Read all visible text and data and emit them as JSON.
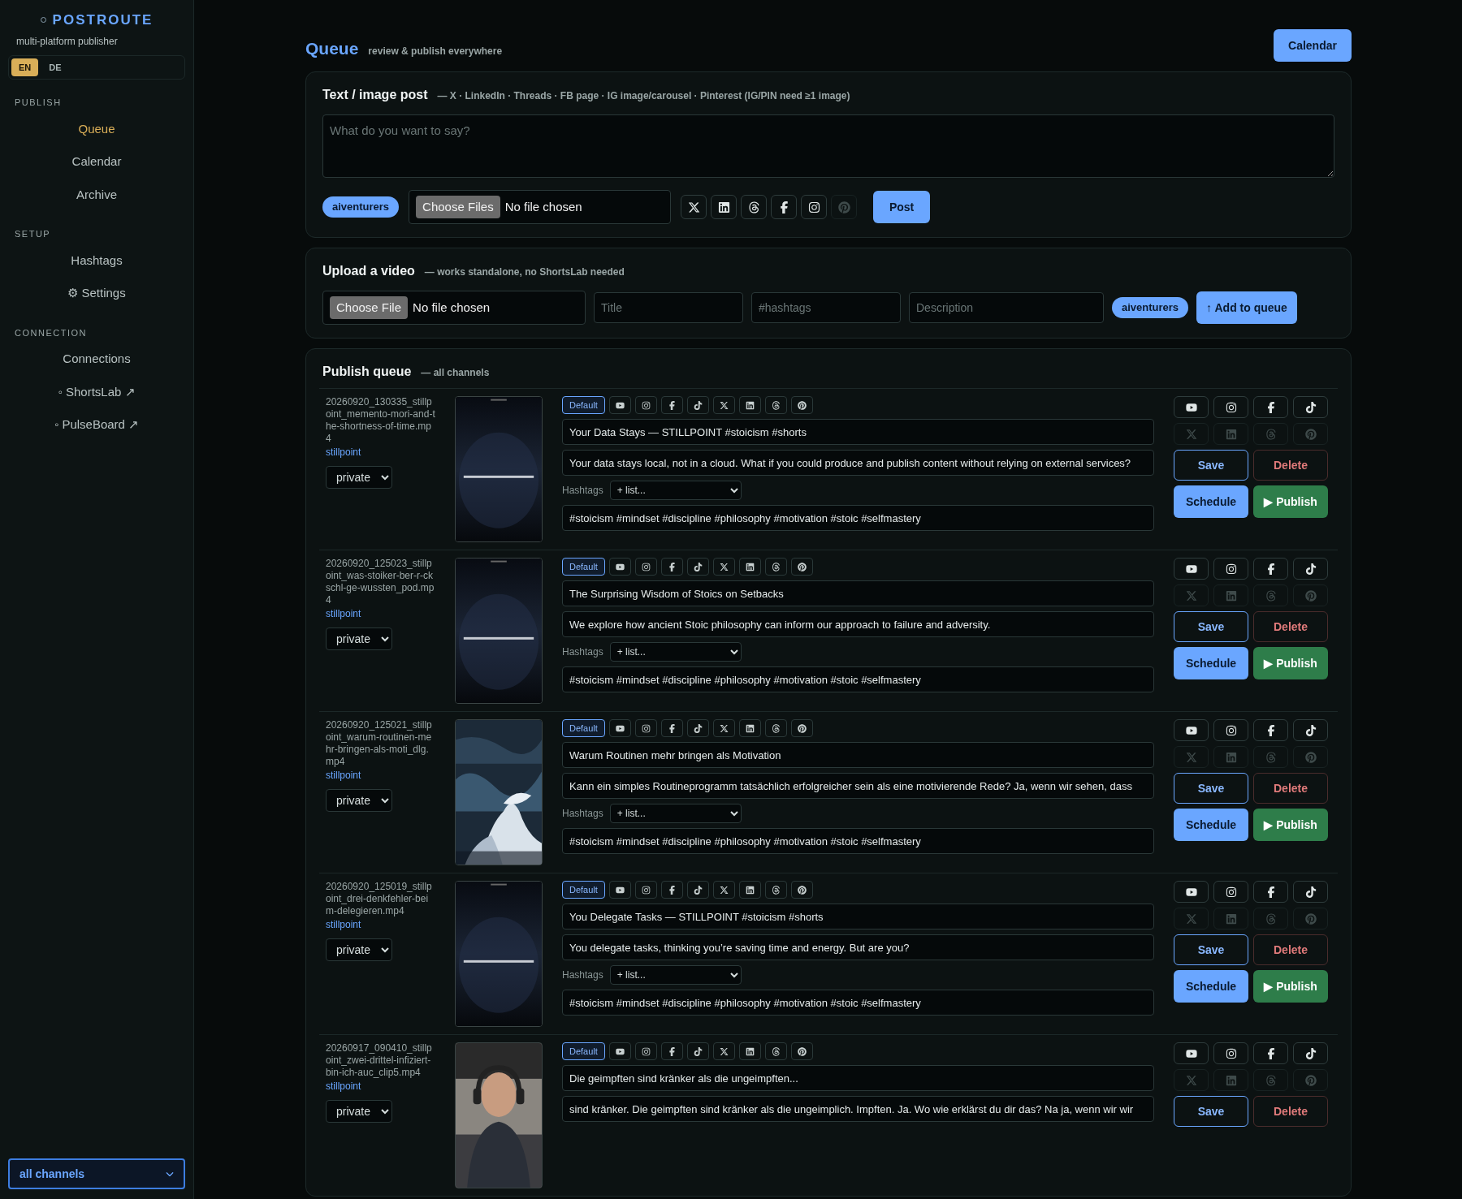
{
  "sidebar": {
    "brand": "POSTROUTE",
    "tagline": "multi-platform publisher",
    "languages": [
      {
        "label": "EN",
        "selected": true
      },
      {
        "label": "DE",
        "selected": false
      }
    ],
    "sections": [
      {
        "title": "PUBLISH",
        "items": [
          {
            "label": "Queue",
            "selected": true
          },
          {
            "label": "Calendar",
            "selected": false
          },
          {
            "label": "Archive",
            "selected": false
          }
        ]
      },
      {
        "title": "SETUP",
        "items": [
          {
            "label": "Hashtags",
            "selected": false
          },
          {
            "label": "⚙ Settings",
            "selected": false
          }
        ]
      },
      {
        "title": "CONNECTION",
        "items": [
          {
            "label": "Connections",
            "selected": false
          },
          {
            "label": "◦ ShortsLab ↗",
            "selected": false
          },
          {
            "label": "◦ PulseBoard ↗",
            "selected": false
          }
        ]
      }
    ],
    "channel_filter": "all channels"
  },
  "header": {
    "title": "Queue",
    "subtitle": "review & publish everywhere",
    "button": "Calendar"
  },
  "text_post": {
    "title": "Text / image post",
    "note": "— X · LinkedIn · Threads · FB page · IG image/carousel · Pinterest (IG/PIN need ≥1 image)",
    "placeholder": "What do you want to say?",
    "account": "aiventurers",
    "file_button": "Choose Files",
    "file_status": "No file chosen",
    "platforms": [
      {
        "kind": "x",
        "on": true
      },
      {
        "kind": "linkedin",
        "on": true
      },
      {
        "kind": "threads",
        "on": true
      },
      {
        "kind": "facebook",
        "on": true
      },
      {
        "kind": "instagram",
        "on": true
      },
      {
        "kind": "pinterest",
        "on": false
      }
    ],
    "submit": "Post"
  },
  "video_upload": {
    "title": "Upload a video",
    "note": "— works standalone, no ShortsLab needed",
    "file_button": "Choose File",
    "file_status": "No file chosen",
    "fields": [
      {
        "placeholder": "Title"
      },
      {
        "placeholder": "#hashtags"
      },
      {
        "placeholder": "Description"
      }
    ],
    "account": "aiventurers",
    "submit": "↑ Add to queue"
  },
  "queue": {
    "title": "Publish queue",
    "note": "— all channels",
    "rows": [
      {
        "file": "20260920_130335_stillpoint_memento-mori-and-the-shortness-of-time.mp4",
        "channel": "stillpoint",
        "privacy": "private",
        "tabs": [
          {
            "kind": "default",
            "label": "Default",
            "selected": true
          },
          {
            "kind": "youtube",
            "selected": false
          },
          {
            "kind": "instagram",
            "selected": false
          },
          {
            "kind": "facebook",
            "selected": false
          },
          {
            "kind": "tiktok",
            "selected": false
          },
          {
            "kind": "x",
            "selected": false
          },
          {
            "kind": "linkedin",
            "selected": false
          },
          {
            "kind": "threads",
            "selected": false
          },
          {
            "kind": "pinterest",
            "selected": false
          }
        ],
        "title": "Your Data Stays — STILLPOINT #stoicism #shorts",
        "description": "Your data stays local, not in a cloud. What if you could produce and publish content without relying on external services?",
        "hashtags_label": "Hashtags",
        "hashtag_list": "+ list...",
        "hashtags": "#stoicism #mindset #discipline #philosophy #motivation #stoic #selfmastery",
        "platforms": [
          {
            "kind": "youtube",
            "on": true
          },
          {
            "kind": "instagram",
            "on": true
          },
          {
            "kind": "facebook",
            "on": true
          },
          {
            "kind": "tiktok",
            "on": true
          },
          {
            "kind": "x",
            "on": false
          },
          {
            "kind": "linkedin",
            "on": false
          },
          {
            "kind": "threads",
            "on": false
          },
          {
            "kind": "pinterest",
            "on": false
          }
        ],
        "save": "Save",
        "delete": "Delete",
        "schedule": "Schedule",
        "publish": "▶ Publish"
      },
      {
        "file": "20260920_125023_stillpoint_was-stoiker-ber-r-ckschl-ge-wussten_pod.mp4",
        "channel": "stillpoint",
        "privacy": "private",
        "tabs": [
          {
            "kind": "default",
            "label": "Default",
            "selected": true
          },
          {
            "kind": "youtube",
            "selected": false
          },
          {
            "kind": "instagram",
            "selected": false
          },
          {
            "kind": "facebook",
            "selected": false
          },
          {
            "kind": "tiktok",
            "selected": false
          },
          {
            "kind": "x",
            "selected": false
          },
          {
            "kind": "linkedin",
            "selected": false
          },
          {
            "kind": "threads",
            "selected": false
          },
          {
            "kind": "pinterest",
            "selected": false
          }
        ],
        "title": "The Surprising Wisdom of Stoics on Setbacks",
        "description": "We explore how ancient Stoic philosophy can inform our approach to failure and adversity.",
        "hashtags_label": "Hashtags",
        "hashtag_list": "+ list...",
        "hashtags": "#stoicism #mindset #discipline #philosophy #motivation #stoic #selfmastery",
        "platforms": [
          {
            "kind": "youtube",
            "on": true
          },
          {
            "kind": "instagram",
            "on": true
          },
          {
            "kind": "facebook",
            "on": true
          },
          {
            "kind": "tiktok",
            "on": true
          },
          {
            "kind": "x",
            "on": false
          },
          {
            "kind": "linkedin",
            "on": false
          },
          {
            "kind": "threads",
            "on": false
          },
          {
            "kind": "pinterest",
            "on": false
          }
        ],
        "save": "Save",
        "delete": "Delete",
        "schedule": "Schedule",
        "publish": "▶ Publish"
      },
      {
        "file": "20260920_125021_stillpoint_warum-routinen-mehr-bringen-als-moti_dlg.mp4",
        "channel": "stillpoint",
        "privacy": "private",
        "tabs": [
          {
            "kind": "default",
            "label": "Default",
            "selected": true
          },
          {
            "kind": "youtube",
            "selected": false
          },
          {
            "kind": "instagram",
            "selected": false
          },
          {
            "kind": "facebook",
            "selected": false
          },
          {
            "kind": "tiktok",
            "selected": false
          },
          {
            "kind": "x",
            "selected": false
          },
          {
            "kind": "linkedin",
            "selected": false
          },
          {
            "kind": "threads",
            "selected": false
          },
          {
            "kind": "pinterest",
            "selected": false
          }
        ],
        "title": "Warum Routinen mehr bringen als Motivation",
        "description": "Kann ein simples Routineprogramm tatsächlich erfolgreicher sein als eine motivierende Rede? Ja, wenn wir sehen, dass",
        "hashtags_label": "Hashtags",
        "hashtag_list": "+ list...",
        "hashtags": "#stoicism #mindset #discipline #philosophy #motivation #stoic #selfmastery",
        "platforms": [
          {
            "kind": "youtube",
            "on": true
          },
          {
            "kind": "instagram",
            "on": true
          },
          {
            "kind": "facebook",
            "on": true
          },
          {
            "kind": "tiktok",
            "on": true
          },
          {
            "kind": "x",
            "on": false
          },
          {
            "kind": "linkedin",
            "on": false
          },
          {
            "kind": "threads",
            "on": false
          },
          {
            "kind": "pinterest",
            "on": false
          }
        ],
        "save": "Save",
        "delete": "Delete",
        "schedule": "Schedule",
        "publish": "▶ Publish"
      },
      {
        "file": "20260920_125019_stillpoint_drei-denkfehler-beim-delegieren.mp4",
        "channel": "stillpoint",
        "privacy": "private",
        "tabs": [
          {
            "kind": "default",
            "label": "Default",
            "selected": true
          },
          {
            "kind": "youtube",
            "selected": false
          },
          {
            "kind": "instagram",
            "selected": false
          },
          {
            "kind": "facebook",
            "selected": false
          },
          {
            "kind": "tiktok",
            "selected": false
          },
          {
            "kind": "x",
            "selected": false
          },
          {
            "kind": "linkedin",
            "selected": false
          },
          {
            "kind": "threads",
            "selected": false
          },
          {
            "kind": "pinterest",
            "selected": false
          }
        ],
        "title": "You Delegate Tasks — STILLPOINT #stoicism #shorts",
        "description": "You delegate tasks, thinking you’re saving time and energy. But are you?",
        "hashtags_label": "Hashtags",
        "hashtag_list": "+ list...",
        "hashtags": "#stoicism #mindset #discipline #philosophy #motivation #stoic #selfmastery",
        "platforms": [
          {
            "kind": "youtube",
            "on": true
          },
          {
            "kind": "instagram",
            "on": true
          },
          {
            "kind": "facebook",
            "on": true
          },
          {
            "kind": "tiktok",
            "on": true
          },
          {
            "kind": "x",
            "on": false
          },
          {
            "kind": "linkedin",
            "on": false
          },
          {
            "kind": "threads",
            "on": false
          },
          {
            "kind": "pinterest",
            "on": false
          }
        ],
        "save": "Save",
        "delete": "Delete",
        "schedule": "Schedule",
        "publish": "▶ Publish"
      },
      {
        "file": "20260917_090410_stillpoint_zwei-drittel-infiziert-bin-ich-auc_clip5.mp4",
        "channel": "stillpoint",
        "privacy": "private",
        "tabs": [
          {
            "kind": "default",
            "label": "Default",
            "selected": true
          },
          {
            "kind": "youtube",
            "selected": false
          },
          {
            "kind": "instagram",
            "selected": false
          },
          {
            "kind": "facebook",
            "selected": false
          },
          {
            "kind": "tiktok",
            "selected": false
          },
          {
            "kind": "x",
            "selected": false
          },
          {
            "kind": "linkedin",
            "selected": false
          },
          {
            "kind": "threads",
            "selected": false
          },
          {
            "kind": "pinterest",
            "selected": false
          }
        ],
        "title": "Die geimpften sind kränker als die ungeimpften...",
        "description": "sind kränker. Die geimpften sind kränker als die ungeimplich. Impften. Ja. Wo wie erklärst du dir das? Na ja, wenn wir wir",
        "platforms": [
          {
            "kind": "youtube",
            "on": true
          },
          {
            "kind": "instagram",
            "on": true
          },
          {
            "kind": "facebook",
            "on": true
          },
          {
            "kind": "tiktok",
            "on": true
          },
          {
            "kind": "x",
            "on": false
          },
          {
            "kind": "linkedin",
            "on": false
          },
          {
            "kind": "threads",
            "on": false
          },
          {
            "kind": "pinterest",
            "on": false
          }
        ],
        "save": "Save",
        "delete": "Delete"
      }
    ]
  }
}
